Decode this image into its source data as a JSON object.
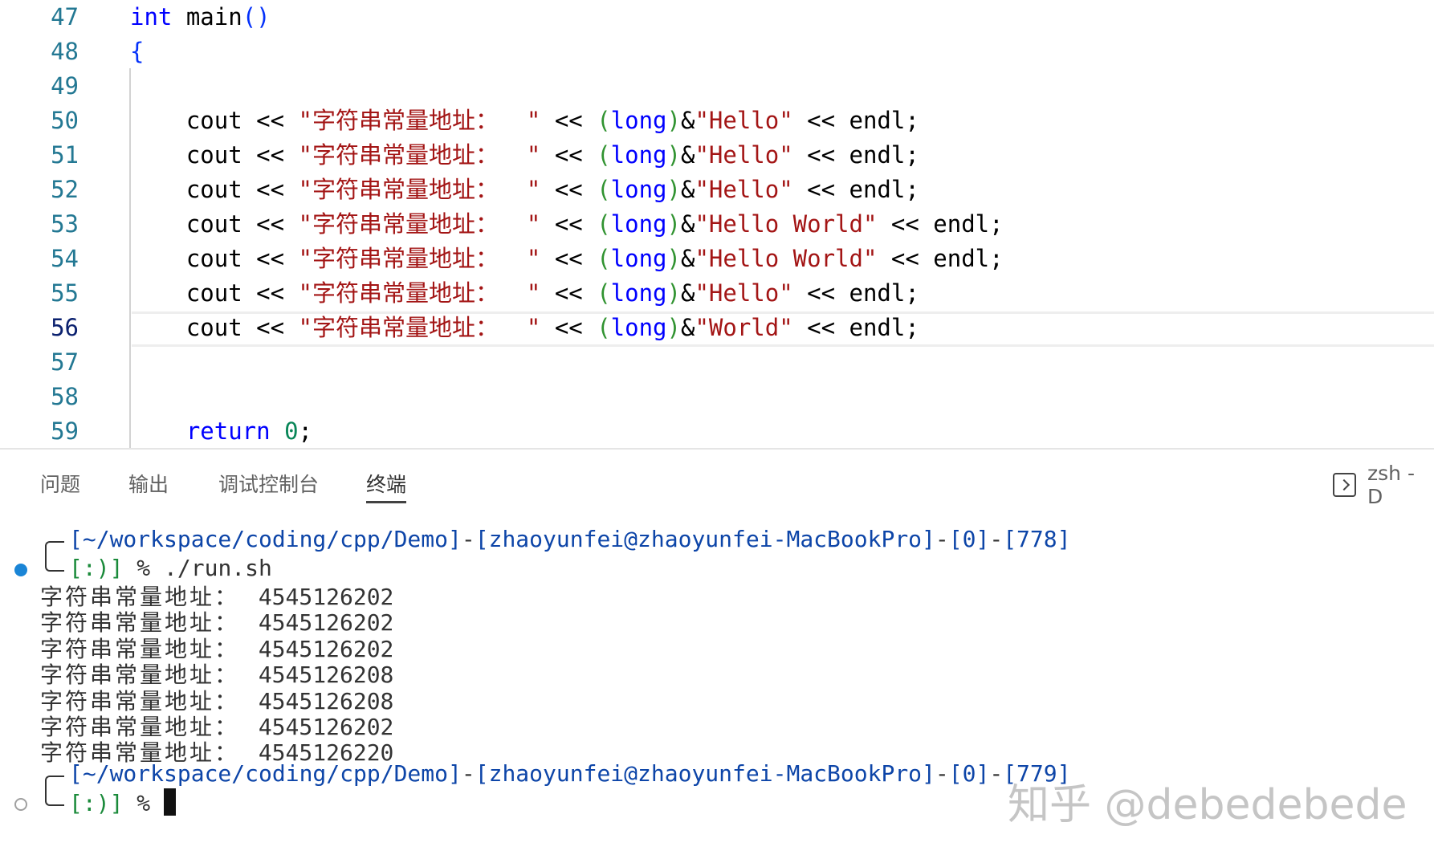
{
  "editor": {
    "lines": [
      {
        "num": "47",
        "tokens": [
          {
            "t": "int",
            "c": "kw"
          },
          {
            "t": " main",
            "c": ""
          },
          {
            "t": "()",
            "c": "paren"
          }
        ]
      },
      {
        "num": "48",
        "tokens": [
          {
            "t": "{",
            "c": "paren"
          }
        ]
      },
      {
        "num": "49",
        "tokens": []
      },
      {
        "num": "50",
        "tokens": [
          {
            "t": "    cout << ",
            "c": ""
          },
          {
            "t": "\"字符串常量地址：  \"",
            "c": "str"
          },
          {
            "t": " << ",
            "c": ""
          },
          {
            "t": "(",
            "c": "paren2"
          },
          {
            "t": "long",
            "c": "type"
          },
          {
            "t": ")",
            "c": "paren2"
          },
          {
            "t": "&",
            "c": ""
          },
          {
            "t": "\"Hello\"",
            "c": "str"
          },
          {
            "t": " << endl;",
            "c": ""
          }
        ]
      },
      {
        "num": "51",
        "tokens": [
          {
            "t": "    cout << ",
            "c": ""
          },
          {
            "t": "\"字符串常量地址：  \"",
            "c": "str"
          },
          {
            "t": " << ",
            "c": ""
          },
          {
            "t": "(",
            "c": "paren2"
          },
          {
            "t": "long",
            "c": "type"
          },
          {
            "t": ")",
            "c": "paren2"
          },
          {
            "t": "&",
            "c": ""
          },
          {
            "t": "\"Hello\"",
            "c": "str"
          },
          {
            "t": " << endl;",
            "c": ""
          }
        ]
      },
      {
        "num": "52",
        "tokens": [
          {
            "t": "    cout << ",
            "c": ""
          },
          {
            "t": "\"字符串常量地址：  \"",
            "c": "str"
          },
          {
            "t": " << ",
            "c": ""
          },
          {
            "t": "(",
            "c": "paren2"
          },
          {
            "t": "long",
            "c": "type"
          },
          {
            "t": ")",
            "c": "paren2"
          },
          {
            "t": "&",
            "c": ""
          },
          {
            "t": "\"Hello\"",
            "c": "str"
          },
          {
            "t": " << endl;",
            "c": ""
          }
        ]
      },
      {
        "num": "53",
        "tokens": [
          {
            "t": "    cout << ",
            "c": ""
          },
          {
            "t": "\"字符串常量地址：  \"",
            "c": "str"
          },
          {
            "t": " << ",
            "c": ""
          },
          {
            "t": "(",
            "c": "paren2"
          },
          {
            "t": "long",
            "c": "type"
          },
          {
            "t": ")",
            "c": "paren2"
          },
          {
            "t": "&",
            "c": ""
          },
          {
            "t": "\"Hello World\"",
            "c": "str"
          },
          {
            "t": " << endl;",
            "c": ""
          }
        ]
      },
      {
        "num": "54",
        "tokens": [
          {
            "t": "    cout << ",
            "c": ""
          },
          {
            "t": "\"字符串常量地址：  \"",
            "c": "str"
          },
          {
            "t": " << ",
            "c": ""
          },
          {
            "t": "(",
            "c": "paren2"
          },
          {
            "t": "long",
            "c": "type"
          },
          {
            "t": ")",
            "c": "paren2"
          },
          {
            "t": "&",
            "c": ""
          },
          {
            "t": "\"Hello World\"",
            "c": "str"
          },
          {
            "t": " << endl;",
            "c": ""
          }
        ]
      },
      {
        "num": "55",
        "tokens": [
          {
            "t": "    cout << ",
            "c": ""
          },
          {
            "t": "\"字符串常量地址：  \"",
            "c": "str"
          },
          {
            "t": " << ",
            "c": ""
          },
          {
            "t": "(",
            "c": "paren2"
          },
          {
            "t": "long",
            "c": "type"
          },
          {
            "t": ")",
            "c": "paren2"
          },
          {
            "t": "&",
            "c": ""
          },
          {
            "t": "\"Hello\"",
            "c": "str"
          },
          {
            "t": " << endl;",
            "c": ""
          }
        ]
      },
      {
        "num": "56",
        "tokens": [
          {
            "t": "    cout << ",
            "c": ""
          },
          {
            "t": "\"字符串常量地址：  \"",
            "c": "str"
          },
          {
            "t": " << ",
            "c": ""
          },
          {
            "t": "(",
            "c": "paren2"
          },
          {
            "t": "long",
            "c": "type"
          },
          {
            "t": ")",
            "c": "paren2"
          },
          {
            "t": "&",
            "c": ""
          },
          {
            "t": "\"World\"",
            "c": "str"
          },
          {
            "t": " << endl;",
            "c": ""
          }
        ]
      },
      {
        "num": "57",
        "tokens": []
      },
      {
        "num": "58",
        "tokens": []
      },
      {
        "num": "59",
        "tokens": [
          {
            "t": "    return ",
            "c": "kw"
          },
          {
            "t": "0",
            "c": "num"
          },
          {
            "t": ";",
            "c": ""
          }
        ]
      }
    ],
    "active_line": "56"
  },
  "panel": {
    "tabs": [
      {
        "label": "问题"
      },
      {
        "label": "输出"
      },
      {
        "label": "调试控制台"
      },
      {
        "label": "终端"
      }
    ],
    "active_tab": "终端",
    "terminal_name": "zsh - D"
  },
  "terminal": {
    "prompt1": {
      "path": "[~/workspace/coding/cpp/Demo]",
      "sep1": "-",
      "user": "[zhaoyunfei@zhaoyunfei-MacBookPro]",
      "sep2": "-",
      "code": "[0]",
      "sep3": "-",
      "count": "[778]",
      "smile": "[:)]",
      "command": " % ./run.sh"
    },
    "output": [
      {
        "label": "字符串常量地址：",
        "value": "4545126202"
      },
      {
        "label": "字符串常量地址：",
        "value": "4545126202"
      },
      {
        "label": "字符串常量地址：",
        "value": "4545126202"
      },
      {
        "label": "字符串常量地址：",
        "value": "4545126208"
      },
      {
        "label": "字符串常量地址：",
        "value": "4545126208"
      },
      {
        "label": "字符串常量地址：",
        "value": "4545126202"
      },
      {
        "label": "字符串常量地址：",
        "value": "4545126220"
      }
    ],
    "prompt2": {
      "path": "[~/workspace/coding/cpp/Demo]",
      "sep1": "-",
      "user": "[zhaoyunfei@zhaoyunfei-MacBookPro]",
      "sep2": "-",
      "code": "[0]",
      "sep3": "-",
      "count": "[779]",
      "smile": "[:)]",
      "command": " % "
    }
  },
  "watermark": "知乎 @debedebede",
  "colors": {
    "line_number": "#237893",
    "keyword": "#0000ff",
    "string": "#a31515",
    "number": "#098658",
    "terminal_blue": "#0d45a8",
    "terminal_green": "#1a8a3a",
    "status_dot": "#1a85d6"
  }
}
